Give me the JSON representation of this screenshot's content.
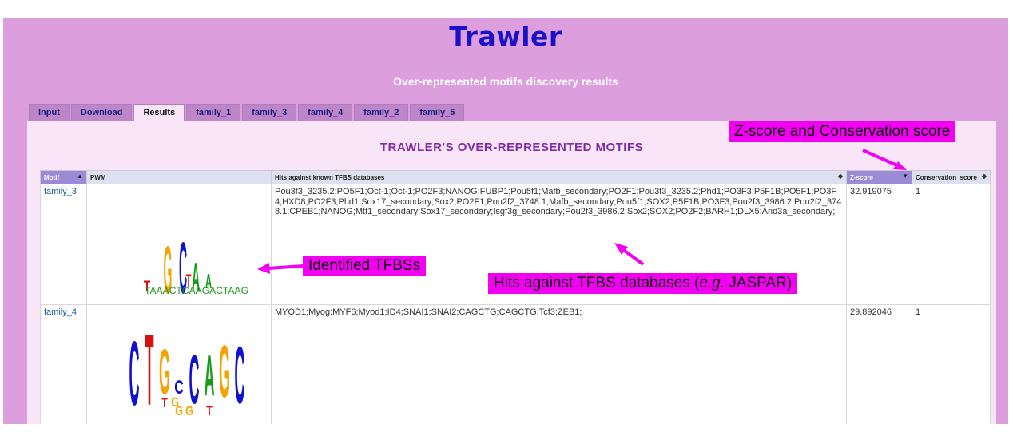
{
  "app_title": "Trawler",
  "subtitle": "Over-represented motifs discovery results",
  "tabs": [
    {
      "label": "Input"
    },
    {
      "label": "Download"
    },
    {
      "label": "Results",
      "active": true
    },
    {
      "label": "family_1"
    },
    {
      "label": "family_3"
    },
    {
      "label": "family_4"
    },
    {
      "label": "family_2"
    },
    {
      "label": "family_5"
    }
  ],
  "section_title": "TRAWLER'S OVER-REPRESENTED MOTIFS",
  "table": {
    "headers": {
      "motif": "Motif",
      "pwm": "PWM",
      "hits": "Hits against known TFBS databases",
      "zscore": "Z-score",
      "conservation": "Conservation_score"
    },
    "sort": {
      "motif": "▲",
      "hits": "◆",
      "zscore": "▼",
      "conservation": "◆"
    },
    "rows": [
      {
        "motif": "family_3",
        "hits": "Pou3f3_3235.2;PO5F1;Oct-1;Oct-1;PO2F3;NANOG;FUBP1;Pou5f1;Mafb_secondary;PO2F1;Pou3f3_3235.2;Phd1;PO3F3;P5F1B;PO5F1;PO3F4;HXD8;PO2F3;Phd1;Sox17_secondary;Sox2;PO2F1;Pou2f2_3748.1;Mafb_secondary;Pou5f1;SOX2;P5F1B;PO3F3;Pou2f3_3986.2;Pou2f2_3748.1;CPEB1;NANOG;Mtf1_secondary;Sox17_secondary;Isgf3g_secondary;Pou2f3_3986.2;Sox2;SOX2;PO2F2;BARH1;DLX5;Arid3a_secondary;",
        "zscore": "32.919075",
        "conservation": "1"
      },
      {
        "motif": "family_4",
        "hits": "MYOD1;Myog;MYF6;Myod1;ID4;SNAI1;SNAI2;CAGCTG;CAGCTG;Tcf3;ZEB1;",
        "zscore": "29.892046",
        "conservation": "1"
      }
    ]
  },
  "annotations": {
    "zscore": "Z-score and Conservation score",
    "tfbs": "Identified TFBSs",
    "hits_prefix": "Hits against TFBS databases (",
    "hits_italic": "e.g.",
    "hits_suffix": " JASPAR)"
  },
  "logo_family_3": {
    "big": [
      "T",
      "G",
      "C",
      "A",
      "T",
      "A"
    ],
    "small": "TAAACTCAAGACTAAG"
  },
  "logo_family_4": {
    "top": [
      "C",
      "T",
      "G",
      "C",
      "C",
      "A",
      "G",
      "C"
    ],
    "bottom": [
      "T",
      "G",
      "G",
      "G",
      "T"
    ]
  },
  "colors": {
    "A": "#1a9a1a",
    "C": "#1111d0",
    "G": "#f5a300",
    "T": "#d31212",
    "page_bg": "#dc9edc",
    "title": "#1a10c8",
    "callout": "#f200f2"
  }
}
